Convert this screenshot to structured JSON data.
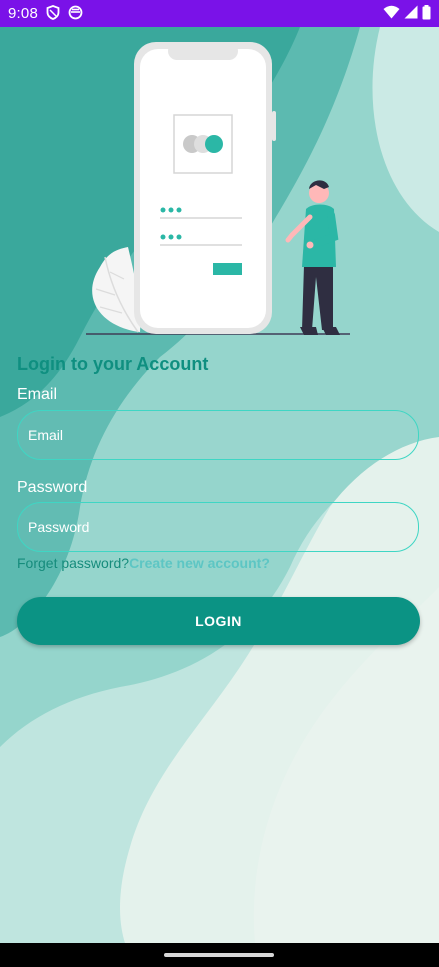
{
  "status_bar": {
    "time": "9:08",
    "icons": [
      "shield-icon",
      "sync-icon",
      "wifi-icon",
      "signal-icon",
      "battery-icon"
    ],
    "background": "#7a12e8"
  },
  "illustration": {
    "icons": [
      "phone-illustration",
      "person-illustration",
      "leaf-illustration"
    ]
  },
  "form": {
    "title": "Login to your Account",
    "email_label": "Email",
    "email_placeholder": "Email",
    "password_label": "Password",
    "password_placeholder": "Password",
    "forgot_link": "Forget password?",
    "create_link": "Create new account?",
    "login_button": "LOGIN"
  },
  "colors": {
    "accent": "#0b9384",
    "field_border": "#3fd6c4",
    "title": "#0f8f80",
    "create_link": "#5dc6c4"
  }
}
